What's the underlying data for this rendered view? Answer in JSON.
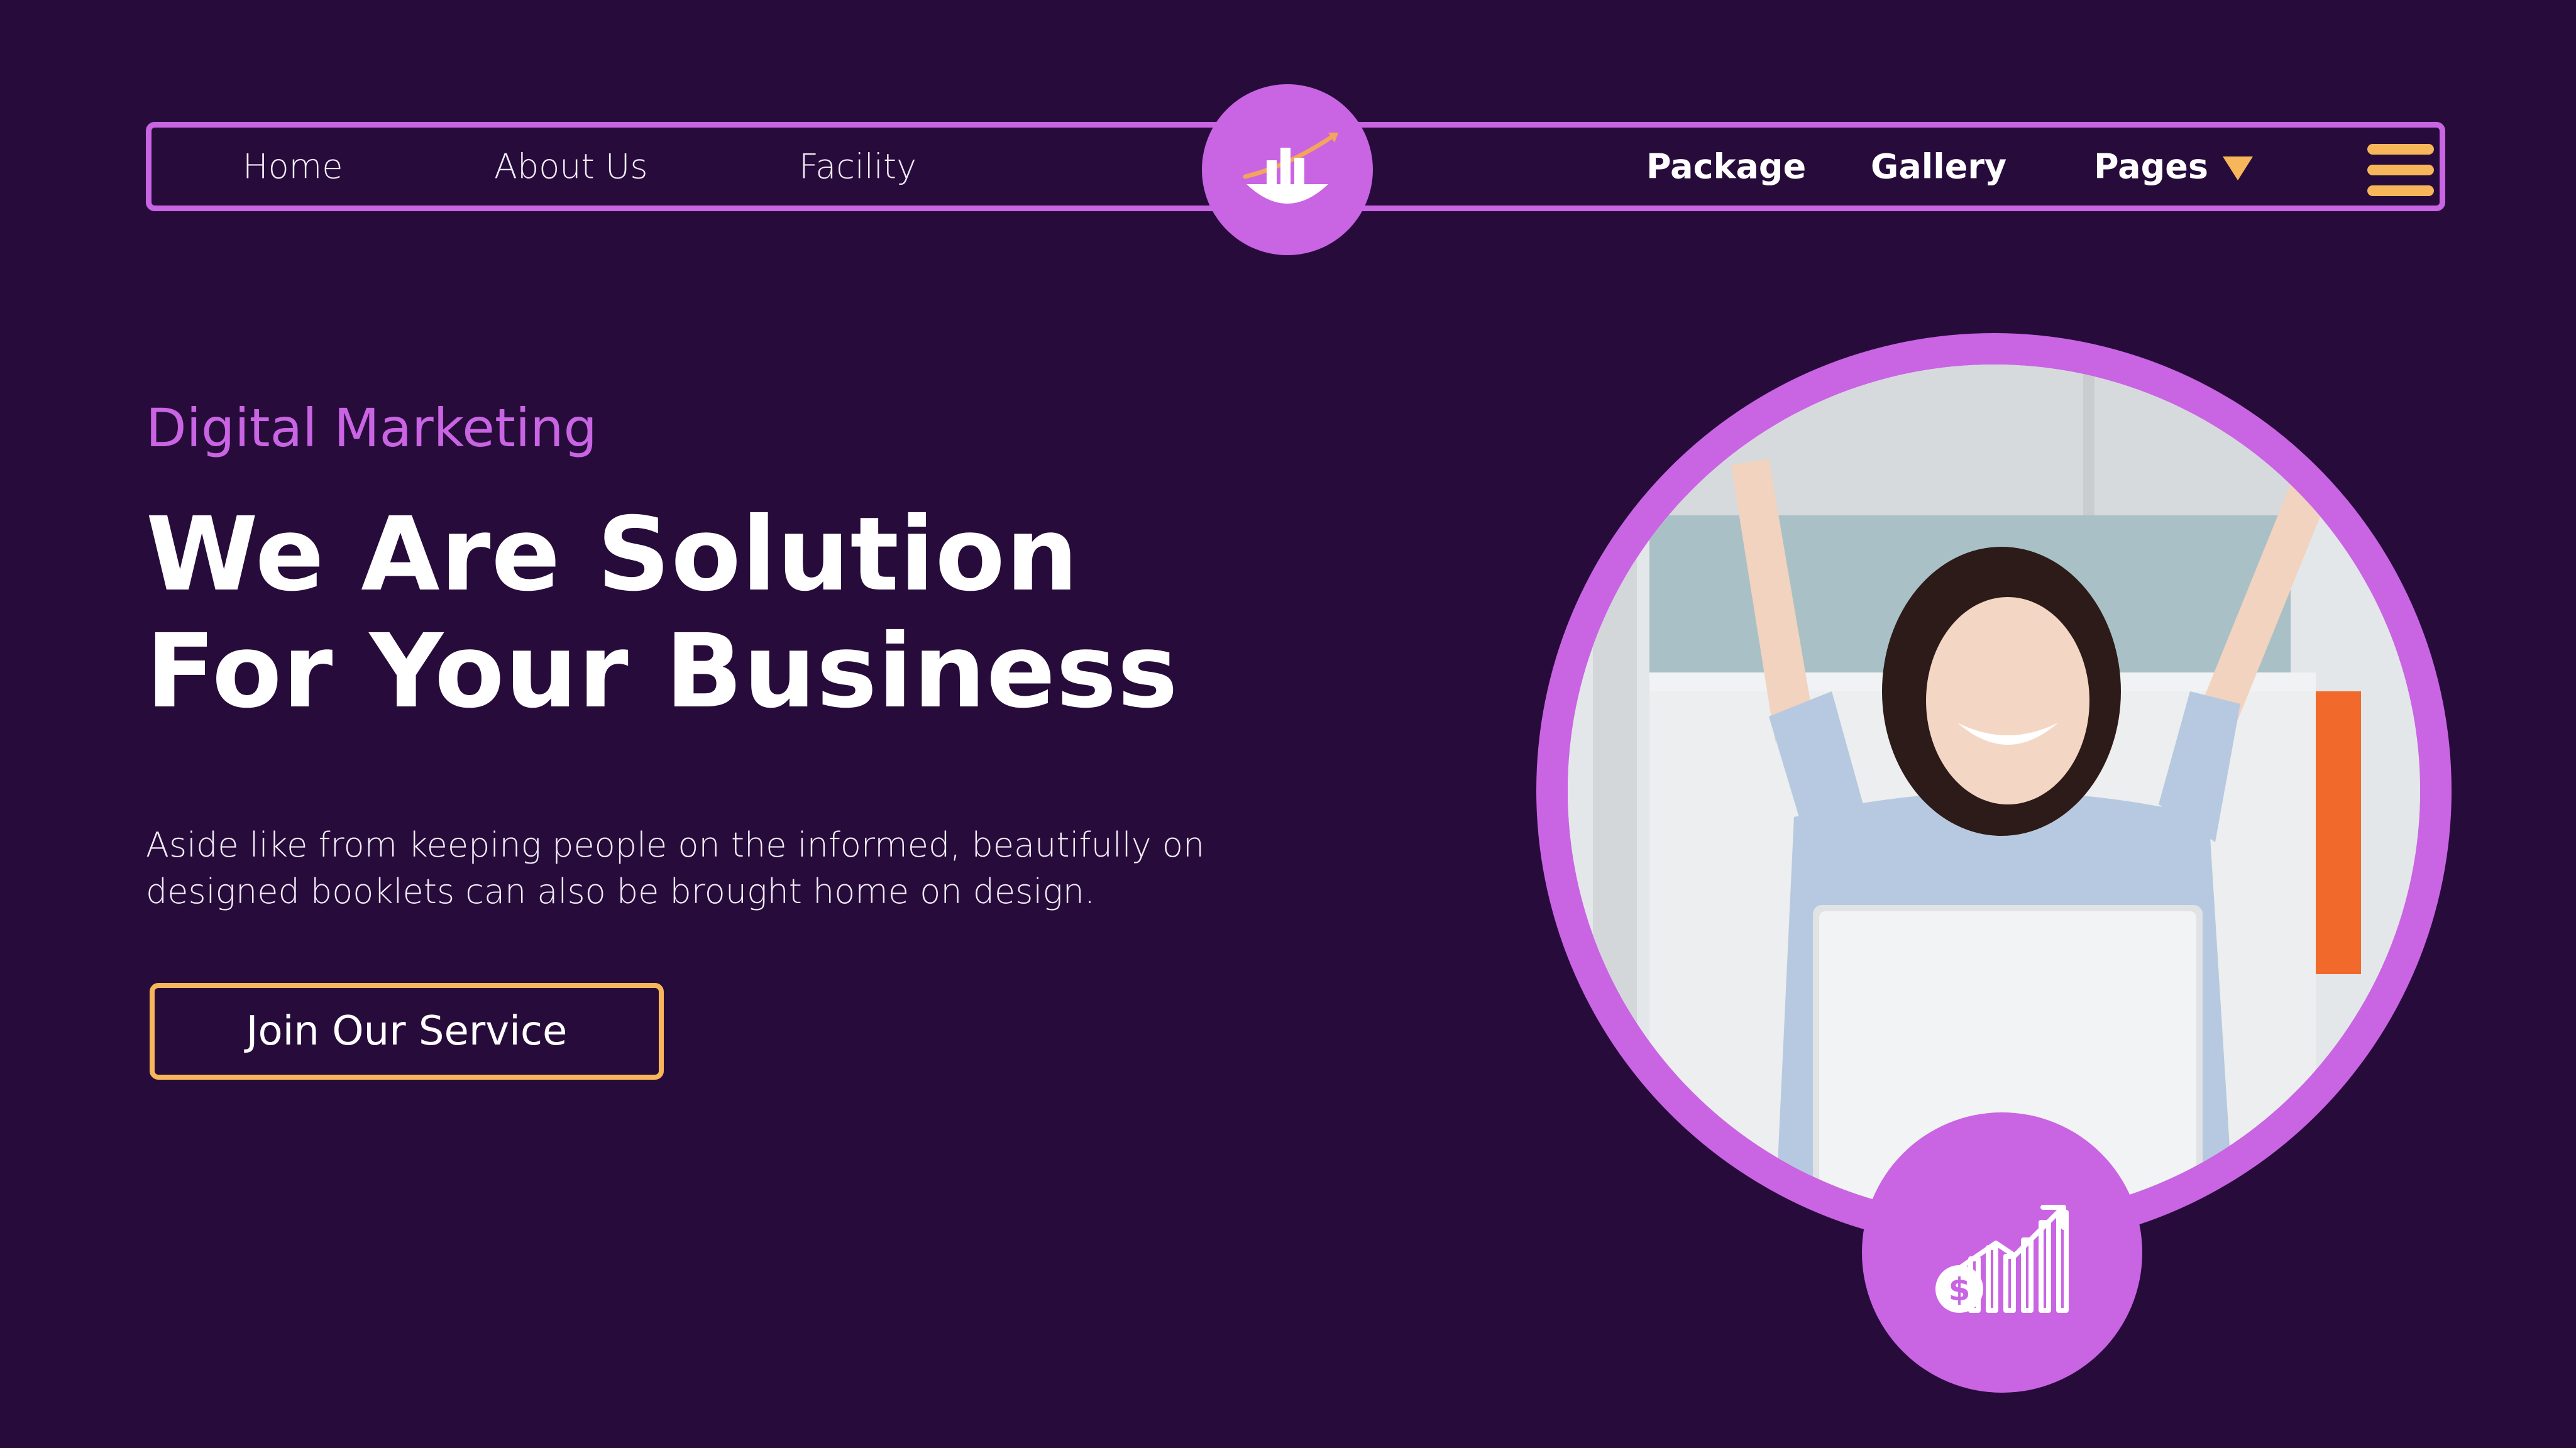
{
  "nav": {
    "left_links": [
      {
        "label": "Home"
      },
      {
        "label": "About Us"
      },
      {
        "label": "Facility"
      }
    ],
    "right_links": [
      {
        "label": "Package"
      },
      {
        "label": "Gallery"
      },
      {
        "label": "Pages"
      }
    ],
    "pages_dropdown_icon": "caret-down-icon",
    "menu_icon": "hamburger-menu-icon",
    "logo_icon": "bar-chart-growth-logo-icon"
  },
  "hero": {
    "eyebrow": "Digital Marketing",
    "headline_lines": [
      "We Are Solution",
      "For Your Business"
    ],
    "description_lines": [
      "Aside like from keeping people on the informed, beautifully on",
      "designed booklets can also be brought home on design."
    ],
    "cta_label": "Join Our Service"
  },
  "media": {
    "photo": "woman-celebrating-at-laptop",
    "badge_icon": "money-growth-chart-icon"
  },
  "colors": {
    "background": "#270c3b",
    "accent_purple": "#c964e3",
    "accent_orange": "#f7b65a",
    "text": "#ffffff"
  }
}
